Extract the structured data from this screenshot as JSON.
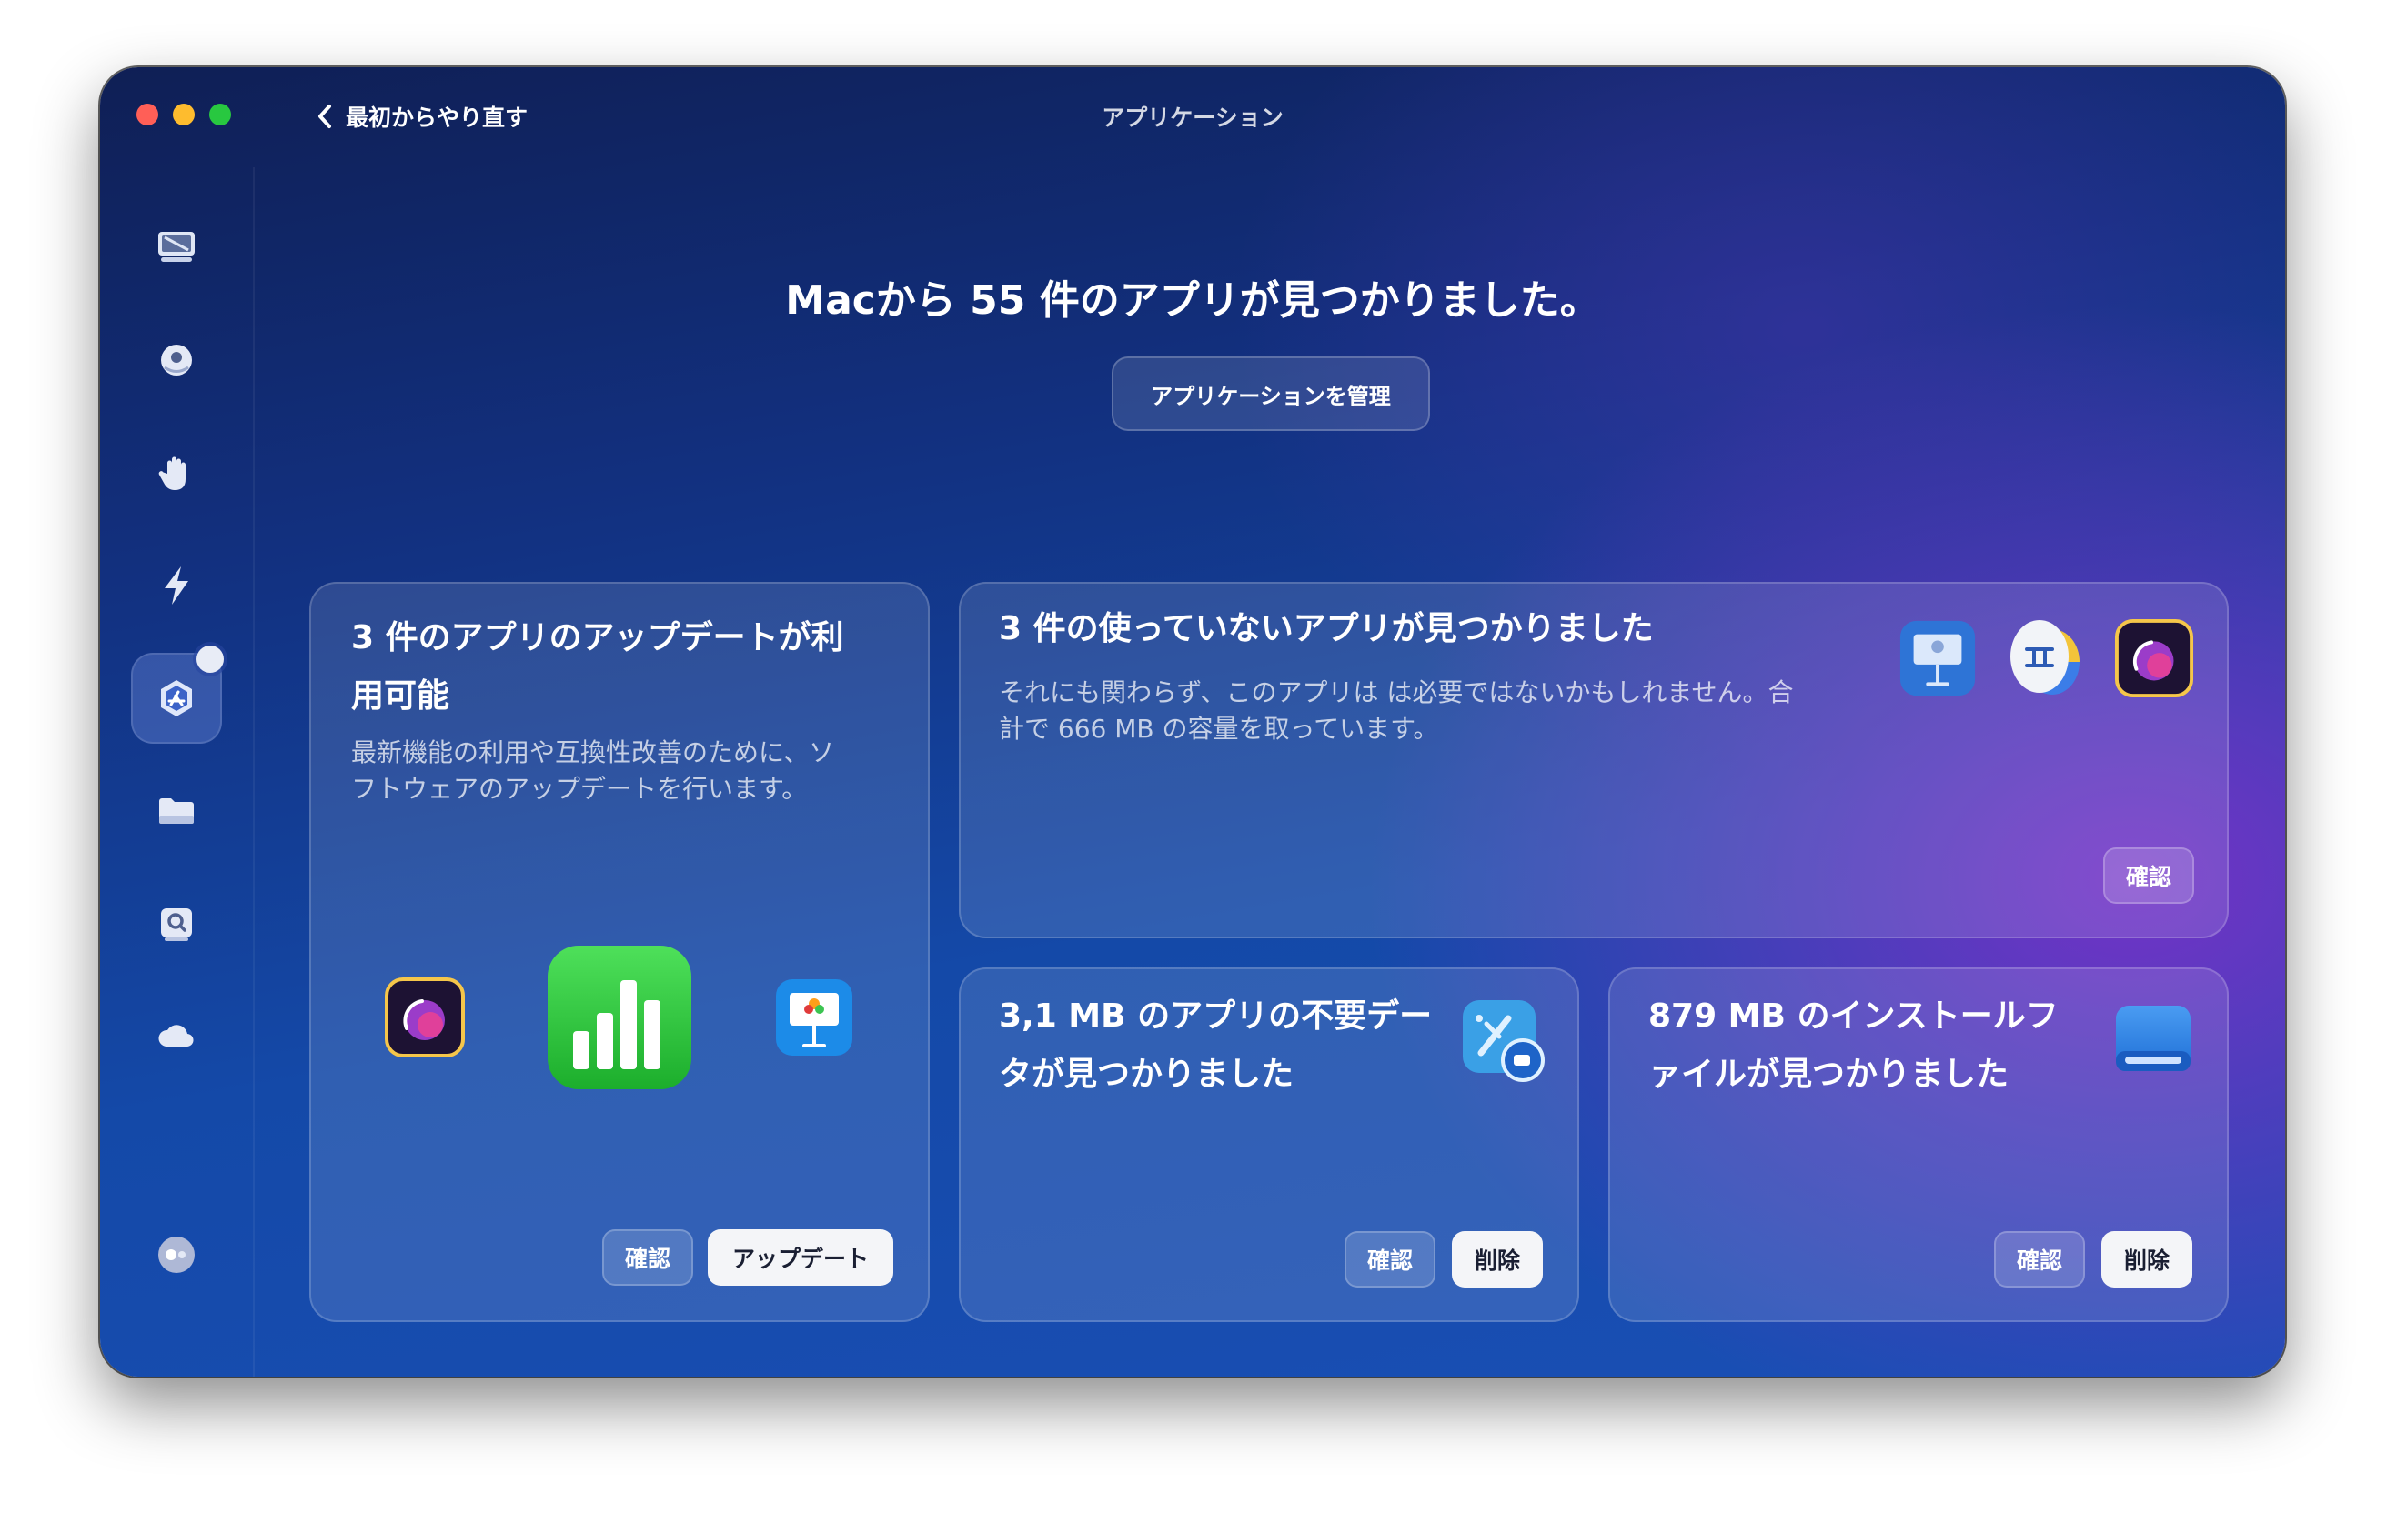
{
  "window": {
    "title": "アプリケーション",
    "back_label": "最初からやり直す"
  },
  "sidebar": {
    "items": [
      {
        "name": "sidebar-item-system",
        "icon": "monitor-icon"
      },
      {
        "name": "sidebar-item-protection",
        "icon": "shield-orb-icon"
      },
      {
        "name": "sidebar-item-privacy",
        "icon": "hand-icon"
      },
      {
        "name": "sidebar-item-performance",
        "icon": "bolt-icon"
      },
      {
        "name": "sidebar-item-applications",
        "icon": "app-store-icon",
        "active": true
      },
      {
        "name": "sidebar-item-files",
        "icon": "folder-icon"
      },
      {
        "name": "sidebar-item-space-lens",
        "icon": "magnifier-icon"
      },
      {
        "name": "sidebar-item-cloud",
        "icon": "cloud-icon"
      }
    ],
    "bottom_icon": "assistant-icon"
  },
  "main": {
    "headline": "Macから 55 件のアプリが見つかりました。",
    "manage_button": "アプリケーションを管理"
  },
  "cards": {
    "updates": {
      "title_line1": "3 件のアプリのアップデートが利",
      "title_line2": "用可能",
      "desc_line1": "最新機能の利用や互換性改善のために、ソ",
      "desc_line2": "フトウェアのアップデートを行います。",
      "review_button": "確認",
      "update_button": "アップデート",
      "icons": [
        "nova-icon",
        "numbers-icon",
        "keynote-icon"
      ]
    },
    "unused": {
      "title": "3 件の使っていないアプリが見つかりました",
      "desc_line1": "それにも関わらず、このアプリは は必要ではないかもしれません。合",
      "desc_line2": "計で 666 MB の容量を取っています。",
      "review_button": "確認",
      "icons": [
        "keynote-icon",
        "gemini-icon",
        "nova-icon"
      ]
    },
    "leftovers": {
      "title_line1": "3,1 MB のアプリの不要デー",
      "title_line2": "タが見つかりました",
      "review_button": "確認",
      "remove_button": "削除",
      "icon": "xcode-leftovers-icon"
    },
    "installers": {
      "title_line1": "879 MB のインストールフ",
      "title_line2": "ァイルが見つかりました",
      "review_button": "確認",
      "remove_button": "削除",
      "icon": "installer-drive-icon"
    }
  }
}
